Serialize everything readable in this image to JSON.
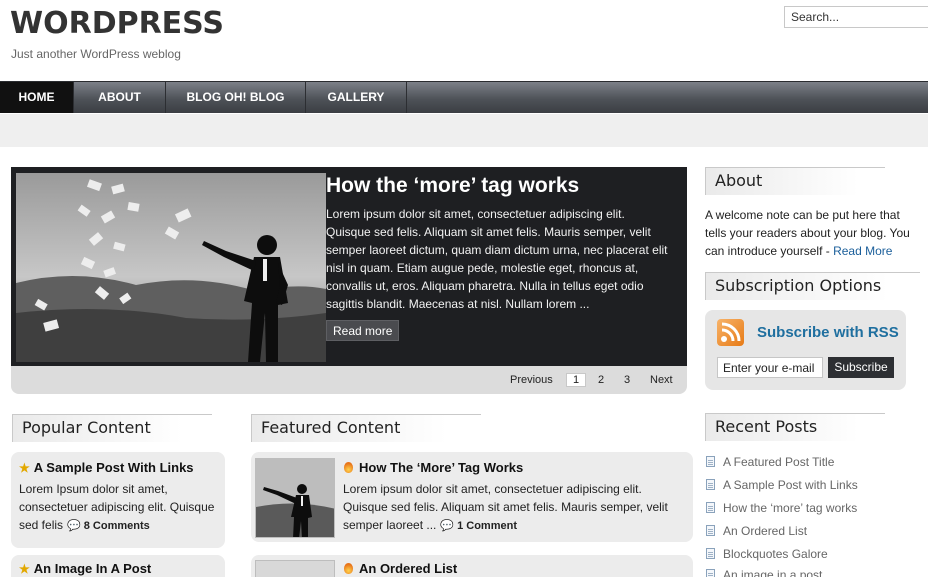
{
  "site": {
    "title": "WORDPRESS",
    "tagline": "Just another WordPress weblog"
  },
  "search": {
    "value": "Search..."
  },
  "nav": {
    "items": [
      "HOME",
      "ABOUT",
      "BLOG OH! BLOG",
      "GALLERY"
    ],
    "active": "HOME"
  },
  "slider": {
    "title": "How the ‘more’ tag works",
    "text": "Lorem ipsum dolor sit amet, consectetuer adipiscing elit. Quisque sed felis. Aliquam sit amet felis. Mauris semper, velit semper laoreet dictum, quam diam dictum urna, nec placerat elit nisl in quam. Etiam augue pede, molestie eget, rhoncus at, convallis ut, eros. Aliquam pharetra. Nulla in tellus eget odio sagittis blandit. Maecenas at nisl. Nullam lorem ...",
    "read_more": "Read more",
    "pager": {
      "previous": "Previous",
      "pages": [
        "1",
        "2",
        "3"
      ],
      "current": "1",
      "next": "Next"
    }
  },
  "about": {
    "title": "About",
    "text": "A welcome note can be put here that tells your readers about your blog. You can introduce yourself - ",
    "link": "Read More"
  },
  "subscription": {
    "title": "Subscription Options",
    "rss_label": "Subscribe with RSS",
    "email_value": "Enter your e-mail",
    "button": "Subscribe"
  },
  "popular": {
    "title": "Popular Content",
    "posts": [
      {
        "title": "A Sample Post With Links",
        "text": "Lorem Ipsum dolor sit amet, consectetuer adipiscing elit. Quisque sed felis",
        "comments": "8 Comments"
      },
      {
        "title": "An Image In A Post"
      }
    ]
  },
  "featured": {
    "title": "Featured Content",
    "posts": [
      {
        "title": "How The ‘More’ Tag Works",
        "text": "Lorem ipsum dolor sit amet, consectetuer adipiscing elit. Quisque sed felis. Aliquam sit amet felis. Mauris semper, velit semper laoreet ...",
        "comments": "1 Comment"
      },
      {
        "title": "An Ordered List"
      }
    ]
  },
  "recent": {
    "title": "Recent Posts",
    "items": [
      "A Featured Post Title",
      "A Sample Post with Links",
      "How the ‘more’ tag works",
      "An Ordered List",
      "Blockquotes Galore",
      "An image in a post"
    ]
  },
  "icons": {
    "search": "search-input",
    "rss": "rss-icon",
    "star": "star-icon",
    "fire": "fire-icon",
    "comment": "comment-bubble-icon",
    "document": "document-icon"
  },
  "colors": {
    "nav_active": "#111111",
    "link": "#1a5e9a",
    "rss_title": "#1f6f9f",
    "slider_bg": "#1e1f22"
  }
}
